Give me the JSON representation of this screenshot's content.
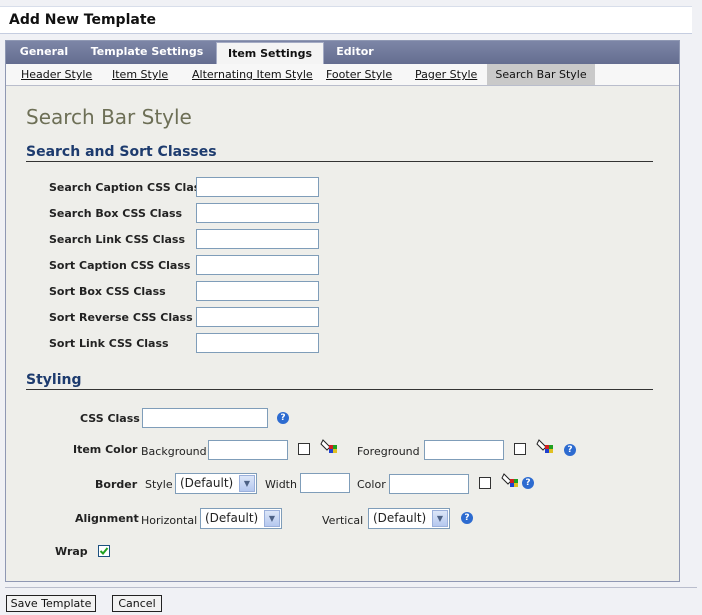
{
  "window": {
    "title": "Add New Template"
  },
  "main_tabs": [
    {
      "label": "General"
    },
    {
      "label": "Template Settings"
    },
    {
      "label": "Item Settings"
    },
    {
      "label": "Editor"
    }
  ],
  "sub_tabs": [
    {
      "label": "Header Style"
    },
    {
      "label": "Item Style"
    },
    {
      "label": "Alternating Item Style"
    },
    {
      "label": "Footer Style"
    },
    {
      "label": "Pager Style"
    },
    {
      "label": "Search Bar Style"
    }
  ],
  "page": {
    "title": "Search Bar Style"
  },
  "search_sort": {
    "heading": "Search and Sort Classes",
    "fields": [
      {
        "label": "Search Caption CSS Class",
        "value": ""
      },
      {
        "label": "Search Box CSS Class",
        "value": ""
      },
      {
        "label": "Search Link CSS Class",
        "value": ""
      },
      {
        "label": "Sort Caption CSS Class",
        "value": ""
      },
      {
        "label": "Sort Box CSS Class",
        "value": ""
      },
      {
        "label": "Sort Reverse CSS Class",
        "value": ""
      },
      {
        "label": "Sort Link CSS Class",
        "value": ""
      }
    ]
  },
  "styling": {
    "heading": "Styling",
    "css_class": {
      "label": "CSS Class",
      "value": ""
    },
    "item_color": {
      "label": "Item Color",
      "background_label": "Background",
      "background_value": "",
      "foreground_label": "Foreground",
      "foreground_value": ""
    },
    "border": {
      "label": "Border",
      "style_label": "Style",
      "style_value": "(Default)",
      "width_label": "Width",
      "width_value": "",
      "color_label": "Color",
      "color_value": ""
    },
    "alignment": {
      "label": "Alignment",
      "horizontal_label": "Horizontal",
      "horizontal_value": "(Default)",
      "vertical_label": "Vertical",
      "vertical_value": "(Default)"
    },
    "wrap": {
      "label": "Wrap",
      "checked": true
    }
  },
  "buttons": {
    "save": "Save Template",
    "cancel": "Cancel"
  },
  "colors": {
    "tab_bar": "#6b7496",
    "heading": "#1d3b6e",
    "page_title": "#6d6f56",
    "active_subtab": "#c9c9c9"
  },
  "icons": {
    "help": "help-icon",
    "picker": "color-picker-icon",
    "check": "checkmark-icon"
  }
}
